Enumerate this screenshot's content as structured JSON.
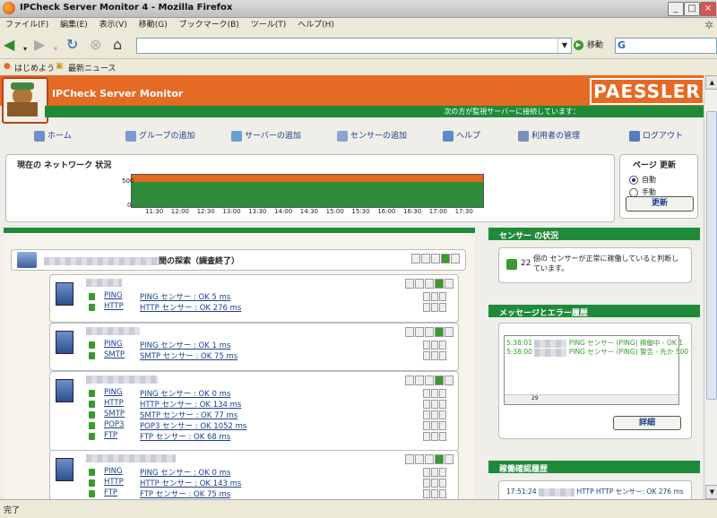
{
  "window": {
    "title": "IPCheck Server Monitor 4 - Mozilla Firefox"
  },
  "browser_menu": [
    "ファイル(F)",
    "編集(E)",
    "表示(V)",
    "移動(G)",
    "ブックマーク(B)",
    "ツール(T)",
    "ヘルプ(H)"
  ],
  "navbar": {
    "url": "",
    "go_label": "移動",
    "search_icon": "G"
  },
  "bookmarks": [
    "はじめよう",
    "最新ニュース"
  ],
  "app": {
    "title": "IPCheck Server Monitor",
    "brand": "PAESSLER",
    "connected_text": "次の方が監視サーバーに接続しています："
  },
  "app_menu": [
    "ホーム",
    "グループの追加",
    "サーバーの追加",
    "センサーの追加",
    "ヘルプ",
    "利用者の管理",
    "ログアウト"
  ],
  "network": {
    "label": "現在の ネットワーク 状況",
    "y_labels": [
      "500",
      "0"
    ],
    "x_labels": [
      "11:30",
      "12:00",
      "12:30",
      "13:00",
      "13:30",
      "14:00",
      "14:30",
      "15:00",
      "15:30",
      "16:00",
      "16:30",
      "17:00",
      "17:30"
    ]
  },
  "refresh": {
    "title": "ページ 更新",
    "auto": "自動",
    "manual": "手動",
    "button": "更新"
  },
  "group": {
    "title_suffix": "間の探索（調査終了）"
  },
  "servers": [
    {
      "sensors": [
        {
          "name": "PING",
          "desc": "PING センサー : OK 5 ms"
        },
        {
          "name": "HTTP",
          "desc": "HTTP センサー : OK 276 ms"
        }
      ]
    },
    {
      "sensors": [
        {
          "name": "PING",
          "desc": "PING センサー : OK 1 ms"
        },
        {
          "name": "SMTP",
          "desc": "SMTP センサー : OK 75 ms"
        }
      ]
    },
    {
      "sensors": [
        {
          "name": "PING",
          "desc": "PING センサー : OK 0 ms"
        },
        {
          "name": "HTTP",
          "desc": "HTTP センサー : OK 134 ms"
        },
        {
          "name": "SMTP",
          "desc": "SMTP センサー : OK 77 ms"
        },
        {
          "name": "POP3",
          "desc": "POP3 センサー : OK 1052 ms"
        },
        {
          "name": "FTP",
          "desc": "FTP センサー : OK 68 ms"
        }
      ]
    },
    {
      "sensors": [
        {
          "name": "PING",
          "desc": "PING センサー : OK 0 ms"
        },
        {
          "name": "HTTP",
          "desc": "HTTP センサー : OK 143 ms"
        },
        {
          "name": "FTP",
          "desc": "FTP センサー : OK 75 ms"
        }
      ]
    }
  ],
  "sensor_status": {
    "title": "センサー の状況",
    "count": "22",
    "text": "個の センサーが正常に稼働していると判断し ています。"
  },
  "messages": {
    "title": "メッセージとエラー履歴",
    "lines": [
      {
        "time": "5:38:01",
        "text": "PING センサー (PING) 稼働中 - OK 1"
      },
      {
        "time": "5:38:00",
        "text": "PING センサー (PING) 警告 - 先か 500"
      }
    ],
    "scroll_marker": "29",
    "button": "詳細"
  },
  "uptime": {
    "title": "稼働確認履歴",
    "line": {
      "time": "17:51:24",
      "text": "HTTP HTTP センサー: OK 276 ms"
    }
  },
  "statusbar": {
    "text": "完了"
  }
}
